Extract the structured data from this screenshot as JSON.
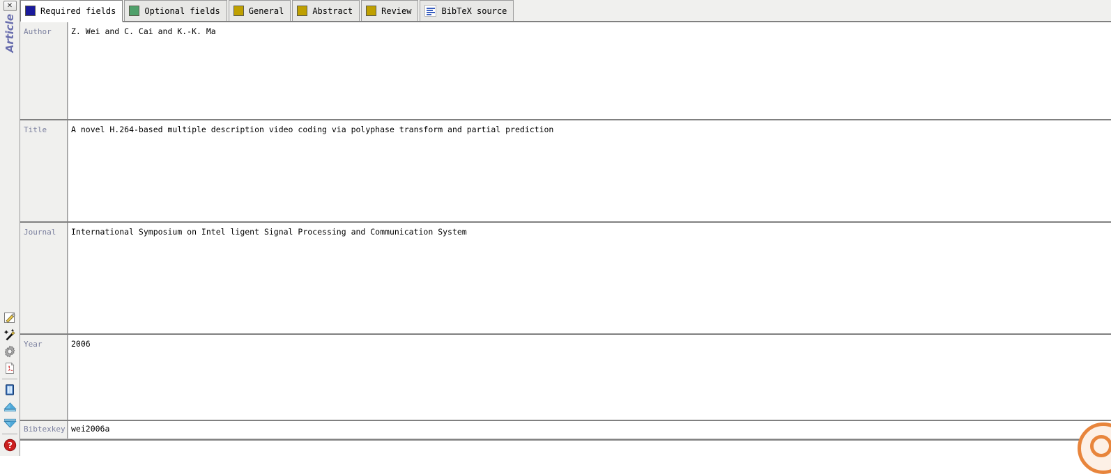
{
  "window": {
    "close_label": "✕",
    "side_label": "Article"
  },
  "tabs": [
    {
      "label": "Required fields",
      "icon": "blue-square-icon",
      "color": "#1a1a9c",
      "active": true
    },
    {
      "label": "Optional fields",
      "icon": "green-square-icon",
      "color": "#4fa06a",
      "active": false
    },
    {
      "label": "General",
      "icon": "olive-square-icon",
      "color": "#bfa000",
      "active": false
    },
    {
      "label": "Abstract",
      "icon": "olive-square-icon",
      "color": "#bfa000",
      "active": false
    },
    {
      "label": "Review",
      "icon": "olive-square-icon",
      "color": "#bfa000",
      "active": false
    },
    {
      "label": "BibTeX source",
      "icon": "bibtex-document-icon",
      "color": "#ffffff",
      "active": false
    }
  ],
  "fields": [
    {
      "label": "Author",
      "value": "Z. Wei and C. Cai and K.-K. Ma"
    },
    {
      "label": "Title",
      "value": "A novel H.264-based multiple description video coding via polyphase transform and partial prediction"
    },
    {
      "label": "Journal",
      "value": "International Symposium on Intel ligent Signal Processing and Communication System"
    },
    {
      "label": "Year",
      "value": "2006"
    },
    {
      "label": "Bibtexkey",
      "value": "wei2006a"
    }
  ],
  "rail_icons": [
    {
      "name": "edit-pencil-icon"
    },
    {
      "name": "magic-wand-icon"
    },
    {
      "name": "gear-icon"
    },
    {
      "name": "pdf-icon"
    },
    {
      "name": "book-icon"
    },
    {
      "name": "arrow-up-icon"
    },
    {
      "name": "arrow-down-icon"
    },
    {
      "name": "help-icon"
    }
  ]
}
